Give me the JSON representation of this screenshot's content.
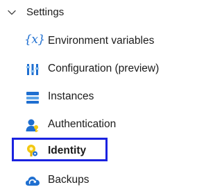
{
  "settings": {
    "header_label": "Settings",
    "expanded": true,
    "items": [
      {
        "label": "Environment variables",
        "icon": "environment-variables-icon",
        "selected": false
      },
      {
        "label": "Configuration (preview)",
        "icon": "configuration-icon",
        "selected": false
      },
      {
        "label": "Instances",
        "icon": "instances-icon",
        "selected": false
      },
      {
        "label": "Authentication",
        "icon": "authentication-icon",
        "selected": false
      },
      {
        "label": "Identity",
        "icon": "identity-icon",
        "selected": true
      },
      {
        "label": "Backups",
        "icon": "backups-icon",
        "selected": false
      }
    ],
    "env_icon_text": "{x}"
  },
  "colors": {
    "selection_border": "#1a22e0",
    "icon_blue": "#1f6fd0",
    "icon_yellow": "#f2c811",
    "text": "#1b1b1b"
  }
}
